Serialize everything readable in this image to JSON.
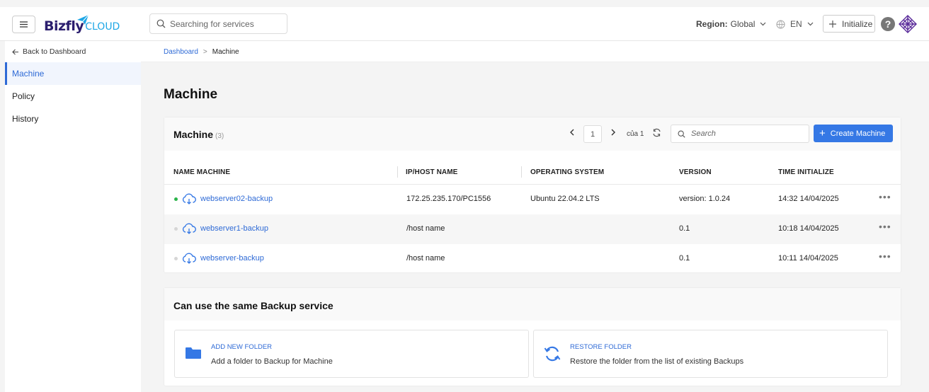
{
  "header": {
    "logo_main": "Bizfly",
    "logo_sub": "CLOUD",
    "search_placeholder": "Searching for services",
    "region_label": "Region:",
    "region_value": "Global",
    "language": "EN",
    "initialize_label": "Initialize",
    "help_label": "?"
  },
  "sidebar": {
    "back_label": "Back to Dashboard",
    "items": [
      {
        "label": "Machine",
        "active": true
      },
      {
        "label": "Policy",
        "active": false
      },
      {
        "label": "History",
        "active": false
      }
    ]
  },
  "breadcrumb": {
    "root": "Dashboard",
    "separator": ">",
    "current": "Machine"
  },
  "page_title": "Machine",
  "machine_card": {
    "title": "Machine",
    "count": "(3)",
    "pager": {
      "current": "1",
      "of_label": "của 1"
    },
    "search_placeholder": "Search",
    "create_label": "Create Machine",
    "columns": [
      "NAME MACHINE",
      "IP/HOST NAME",
      "OPERATING SYSTEM",
      "VERSION",
      "TIME INITIALIZE"
    ],
    "rows": [
      {
        "name": "webserver02-backup",
        "ip": "172.25.235.170/PC1556",
        "os": "Ubuntu 22.04.2 LTS",
        "version": "version: 1.0.24",
        "time": "14:32 14/04/2025",
        "status_color": "#2bb44a"
      },
      {
        "name": "webserver1-backup",
        "ip": "/host name",
        "os": "",
        "version": "0.1",
        "time": "10:18 14/04/2025",
        "status_color": "#d6d6d6"
      },
      {
        "name": "webserver-backup",
        "ip": "/host name",
        "os": "",
        "version": "0.1",
        "time": "10:11 14/04/2025",
        "status_color": "#d6d6d6"
      }
    ],
    "more_label": "•••"
  },
  "service_card": {
    "title": "Can use the same Backup service",
    "tiles": [
      {
        "title": "ADD NEW FOLDER",
        "desc": "Add a folder to Backup for Machine",
        "icon": "folder-icon"
      },
      {
        "title": "RESTORE FOLDER",
        "desc": "Restore the folder from the list of existing Backups",
        "icon": "restore-icon"
      }
    ]
  },
  "colors": {
    "accent": "#3578e5",
    "link": "#2e6ad6",
    "online": "#2bb44a"
  }
}
